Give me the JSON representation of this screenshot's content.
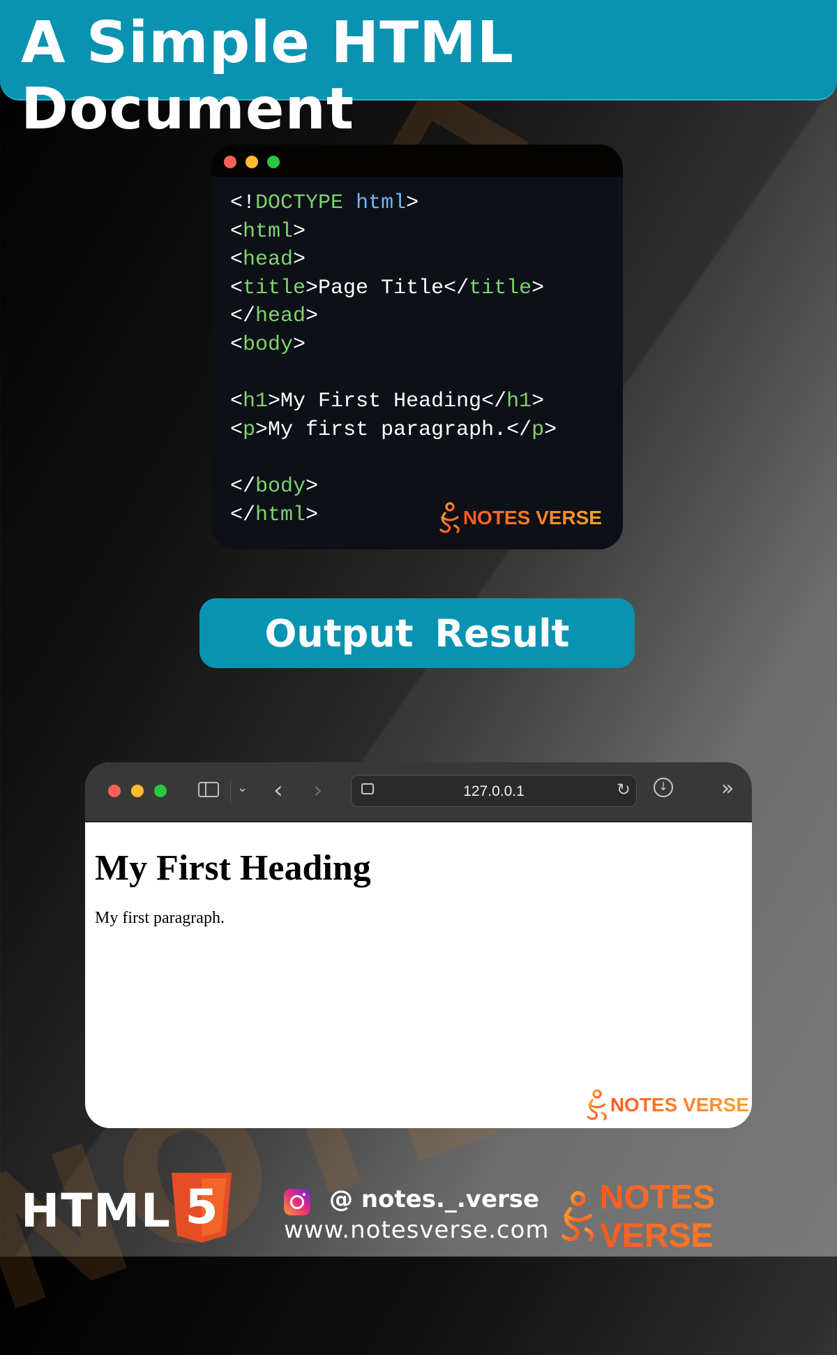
{
  "banner": {
    "title": "A Simple HTML Document"
  },
  "code_window": {
    "lines": [
      [
        [
          "punct",
          "<!"
        ],
        [
          "tag",
          "DOCTYPE"
        ],
        [
          "txt",
          " "
        ],
        [
          "attr",
          "html"
        ],
        [
          "punct",
          ">"
        ]
      ],
      [
        [
          "punct",
          "<"
        ],
        [
          "tag",
          "html"
        ],
        [
          "punct",
          ">"
        ]
      ],
      [
        [
          "punct",
          "<"
        ],
        [
          "tag",
          "head"
        ],
        [
          "punct",
          ">"
        ]
      ],
      [
        [
          "punct",
          "<"
        ],
        [
          "tag",
          "title"
        ],
        [
          "punct",
          ">"
        ],
        [
          "txt",
          "Page Title"
        ],
        [
          "punct",
          "</"
        ],
        [
          "tag",
          "title"
        ],
        [
          "punct",
          ">"
        ]
      ],
      [
        [
          "punct",
          "</"
        ],
        [
          "tag",
          "head"
        ],
        [
          "punct",
          ">"
        ]
      ],
      [
        [
          "punct",
          "<"
        ],
        [
          "tag",
          "body"
        ],
        [
          "punct",
          ">"
        ]
      ],
      [],
      [
        [
          "punct",
          "<"
        ],
        [
          "tag",
          "h1"
        ],
        [
          "punct",
          ">"
        ],
        [
          "txt",
          "My First Heading"
        ],
        [
          "punct",
          "</"
        ],
        [
          "tag",
          "h1"
        ],
        [
          "punct",
          ">"
        ]
      ],
      [
        [
          "punct",
          "<"
        ],
        [
          "tag",
          "p"
        ],
        [
          "punct",
          ">"
        ],
        [
          "txt",
          "My first paragraph."
        ],
        [
          "punct",
          "</"
        ],
        [
          "tag",
          "p"
        ],
        [
          "punct",
          ">"
        ]
      ],
      [],
      [
        [
          "punct",
          "</"
        ],
        [
          "tag",
          "body"
        ],
        [
          "punct",
          ">"
        ]
      ],
      [
        [
          "punct",
          "</"
        ],
        [
          "tag",
          "html"
        ],
        [
          "punct",
          ">"
        ]
      ]
    ],
    "logo_text": "NOTES VERSE"
  },
  "output_button": {
    "label": "Output  Result"
  },
  "browser": {
    "address": "127.0.0.1",
    "page_heading": "My First Heading",
    "page_paragraph": "My first paragraph.",
    "logo_text": "NOTES VERSE"
  },
  "footer": {
    "html_label": "HTML",
    "html5_number": "5",
    "instagram_handle": "@ notes._.verse",
    "website": "www.notesverse.com",
    "logo_text": "NOTES VERSE"
  },
  "watermark_text": "NOTES VERSE",
  "colors": {
    "accent": "#0a93b0",
    "code_bg": "#0d1017",
    "tag": "#7fd36d",
    "attr": "#75b4f5",
    "logo_gradient_start": "#ff5a1f",
    "logo_gradient_end": "#ffa12e",
    "html5_orange": "#e44d26"
  }
}
